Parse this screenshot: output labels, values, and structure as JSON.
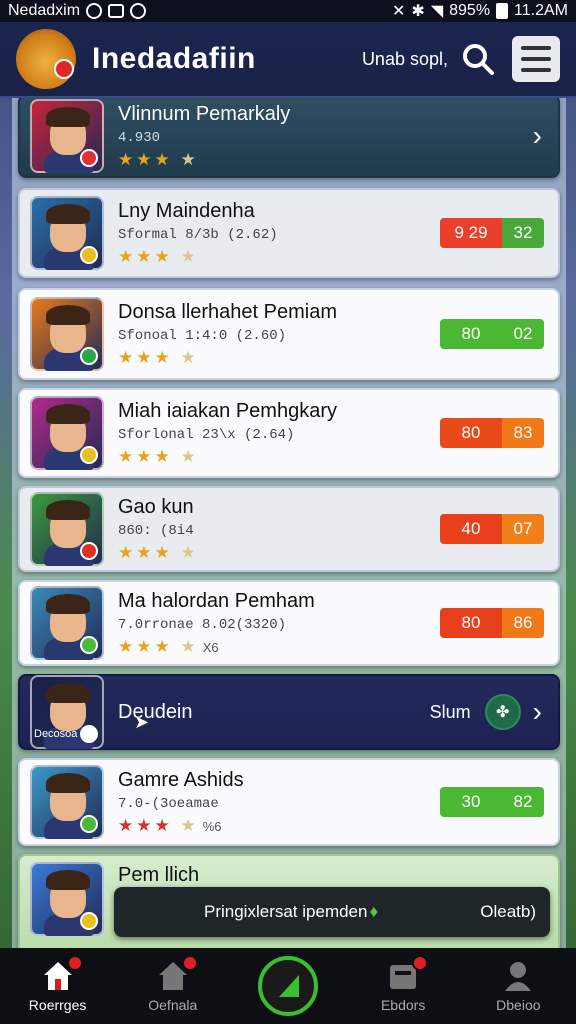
{
  "status_bar": {
    "left_text": "Nedadxim",
    "battery": "895%",
    "time": "11.2AM"
  },
  "header": {
    "title": "Inedadafiin",
    "search_label": "Unab sopl,"
  },
  "items": [
    {
      "title": "Vlinnum Pemarkaly",
      "subtitle": "4.930",
      "style": "teal",
      "action": "chevron",
      "avatar_bg": "#c8243a",
      "badge_color": "#e03030",
      "stars": "partial"
    },
    {
      "title": "Lny Maindenha",
      "subtitle": "Sformal 8/3b (2.62)",
      "style": "grey",
      "score_left": "9 29",
      "score_right": "32",
      "score_left_color": "#e8402a",
      "score_right_color": "#4aa83a",
      "avatar_bg": "#2a6fa8",
      "badge_color": "#e8c020"
    },
    {
      "title": "Donsa llerhahet Pemiam",
      "subtitle": "Sfonoal 1:4:0 (2.60)",
      "style": "light",
      "score_left": "80",
      "score_right": "02",
      "score_left_color": "#4bb834",
      "score_right_color": "#4bb834",
      "avatar_bg": "#e87a1a",
      "badge_color": "#2aa848"
    },
    {
      "title": "Miah iaiakan Pemhgkary",
      "subtitle": "Sforlonal 23\\x (2.64)",
      "style": "light",
      "score_left": "80",
      "score_right": "83",
      "score_left_color": "#e84a1a",
      "score_right_color": "#f07a1a",
      "avatar_bg": "#b02a8a",
      "badge_color": "#e8c020"
    },
    {
      "title": "Gao kun",
      "subtitle": "860: (8i4",
      "style": "grey",
      "score_left": "40",
      "score_right": "07",
      "score_left_color": "#e8401a",
      "score_right_color": "#f0801a",
      "avatar_bg": "#3a9a3a",
      "badge_color": "#e03020"
    },
    {
      "title": "Ma halordan Pemham",
      "subtitle": "7.0rronae 8.02(3320)",
      "style": "light",
      "score_left": "80",
      "score_right": "86",
      "score_left_color": "#e8401a",
      "score_right_color": "#f07a1a",
      "avatar_bg": "#3a8ab8",
      "badge_color": "#4ab83a",
      "stars_extra": "X6"
    },
    {
      "title": "Deudein",
      "subtitle": "Decosoa",
      "style": "dark",
      "action": "slum",
      "action_label": "Slum",
      "avatar_bg": "#1a1f48",
      "badge_color": "#ffffff"
    },
    {
      "title": "Gamre Ashids",
      "subtitle": "7.0-(3oeamae",
      "style": "light",
      "score_left": "30",
      "score_right": "82",
      "score_left_color": "#4bb834",
      "score_right_color": "#4bb834",
      "avatar_bg": "#3a9ac8",
      "badge_color": "#4ab83a",
      "stars_extra": "%6",
      "stars_red": true
    },
    {
      "title": "Pem llich",
      "style": "green",
      "avatar_bg": "#3a7ad8",
      "badge_color": "#e8c020"
    }
  ],
  "toast": {
    "message": "Pringixlersat ipemden",
    "action": "Oleatb)"
  },
  "bottom_nav": [
    {
      "label": "Roerrges",
      "icon": "home-icon",
      "active": true,
      "badge": true
    },
    {
      "label": "Oefnala",
      "icon": "store-icon",
      "active": false,
      "badge": true
    },
    {
      "label": "",
      "icon": "play-icon",
      "active": false,
      "badge": false
    },
    {
      "label": "Ebdors",
      "icon": "inbox-icon",
      "active": false,
      "badge": true
    },
    {
      "label": "Dbeioo",
      "icon": "profile-icon",
      "active": false,
      "badge": false
    }
  ]
}
